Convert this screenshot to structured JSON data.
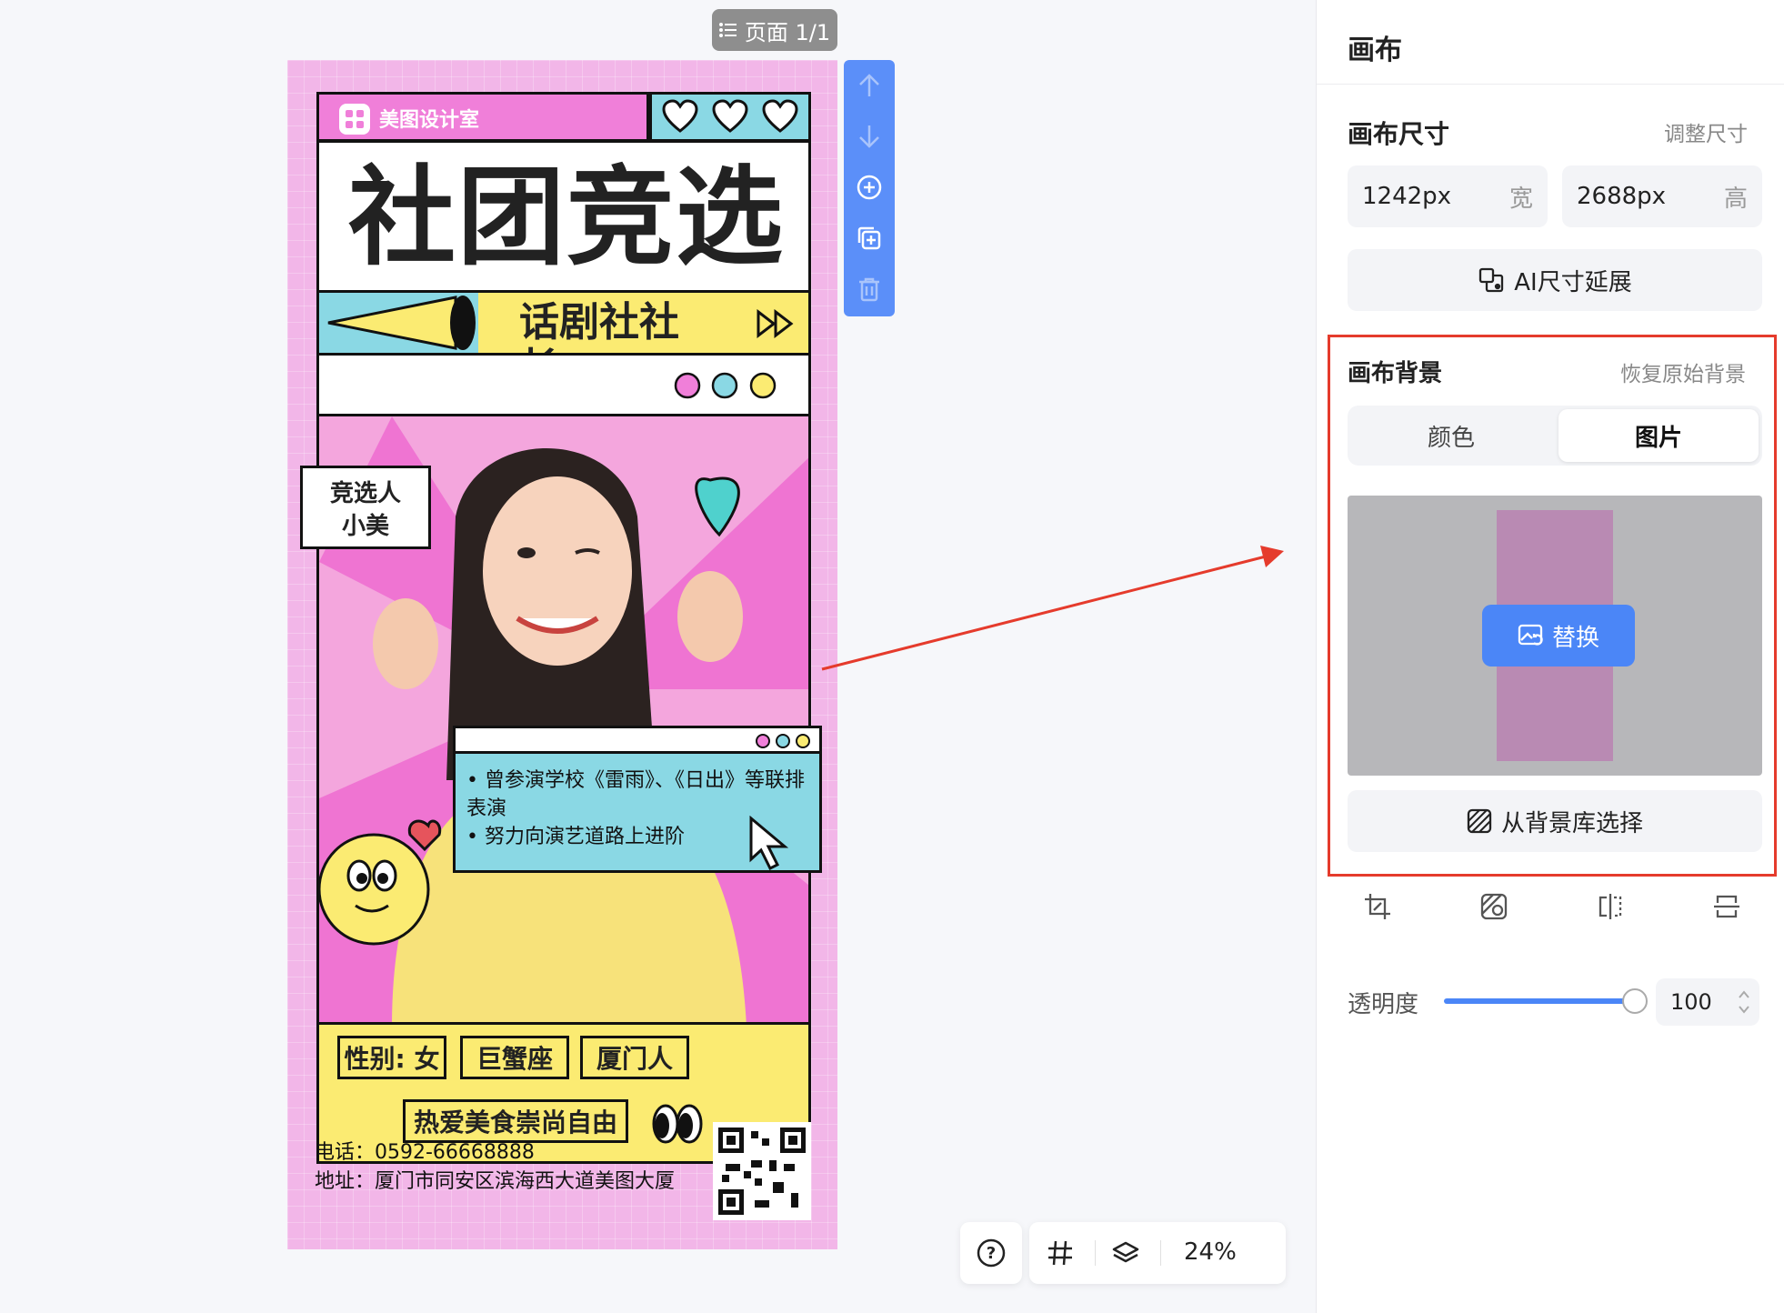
{
  "canvas": {
    "page_label": "页面 1/1",
    "zoom": "24%"
  },
  "poster": {
    "brand": "美图设计室",
    "title": "社团竞选",
    "subtitle": "话剧社社长",
    "candidate_line1": "竞选人",
    "candidate_line2": "小美",
    "bullets": [
      "曾参演学校《雷雨》、《日出》等联排表演",
      "努力向演艺道路上进阶"
    ],
    "tags": [
      "性别: 女",
      "巨蟹座",
      "厦门人",
      "热爱美食崇尚自由"
    ],
    "phone": "电话：0592-66668888",
    "address": "地址：厦门市同安区滨海西大道美图大厦"
  },
  "panel": {
    "title": "画布",
    "size_section": "画布尺寸",
    "resize_link": "调整尺寸",
    "width_value": "1242px",
    "width_unit": "宽",
    "height_value": "2688px",
    "height_unit": "高",
    "ai_extend": "AI尺寸延展",
    "bg_section": "画布背景",
    "restore_link": "恢复原始背景",
    "tab_color": "颜色",
    "tab_image": "图片",
    "replace_label": "替换",
    "from_library": "从背景库选择",
    "opacity_label": "透明度",
    "opacity_value": "100"
  },
  "colors": {
    "accent": "#4b86f7",
    "annotation": "#e53b2c",
    "poster_pink": "#f07fd9",
    "poster_blue": "#8ad8e4",
    "poster_yellow": "#fbeb72"
  }
}
